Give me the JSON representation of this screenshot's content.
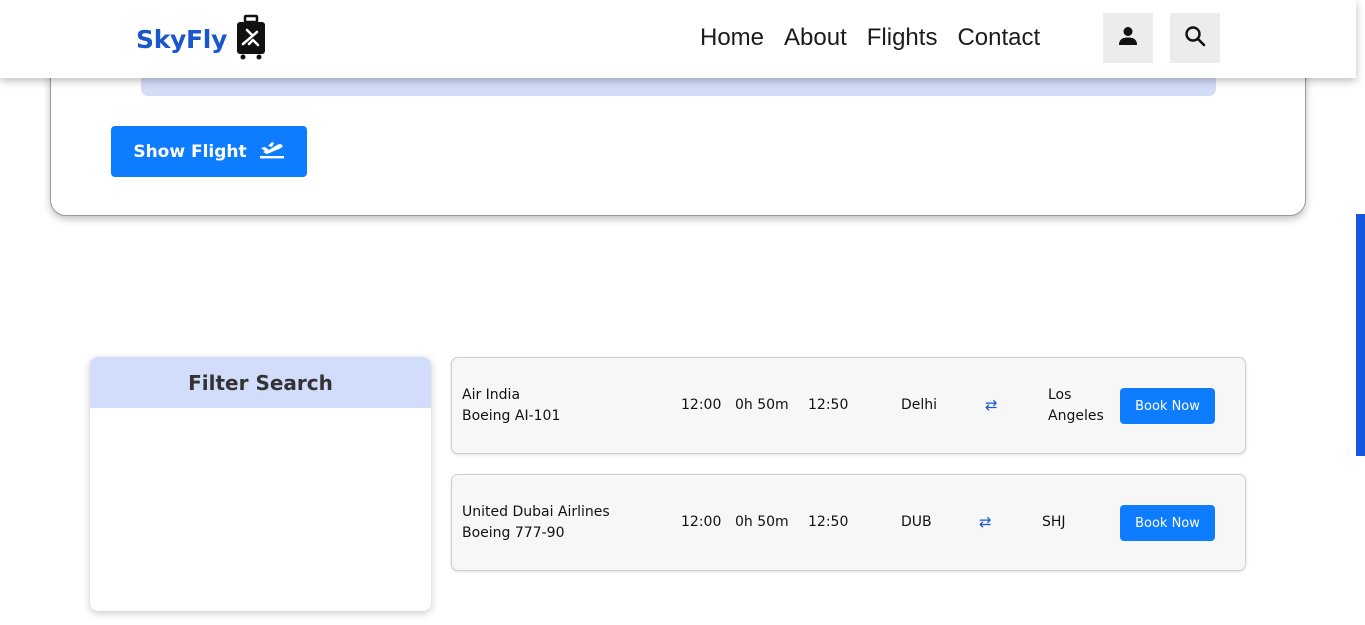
{
  "header": {
    "logo_text": "SkyFly",
    "nav": [
      "Home",
      "About",
      "Flights",
      "Contact"
    ],
    "user_icon": "user-icon",
    "search_icon": "search-icon"
  },
  "search": {
    "show_flight_label": "Show Flight",
    "show_flight_icon": "plane-departure-icon"
  },
  "filter": {
    "title": "Filter Search"
  },
  "flights": [
    {
      "airline": "Air India",
      "aircraft": "Boeing AI-101",
      "departure": "12:00",
      "duration": "0h 50m",
      "arrival": "12:50",
      "from": "Delhi",
      "to_line1": "Los",
      "to_line2": "Angeles",
      "book_label": "Book Now"
    },
    {
      "airline": "United Dubai Airlines",
      "aircraft": "Boeing 777-90",
      "departure": "12:00",
      "duration": "0h 50m",
      "arrival": "12:50",
      "from": "DUB",
      "to_line1": "SHJ",
      "to_line2": "",
      "book_label": "Book Now"
    }
  ],
  "colors": {
    "brand": "#1a56cc",
    "primary_button": "#0d7cff",
    "filter_header": "#d2dcfb"
  }
}
